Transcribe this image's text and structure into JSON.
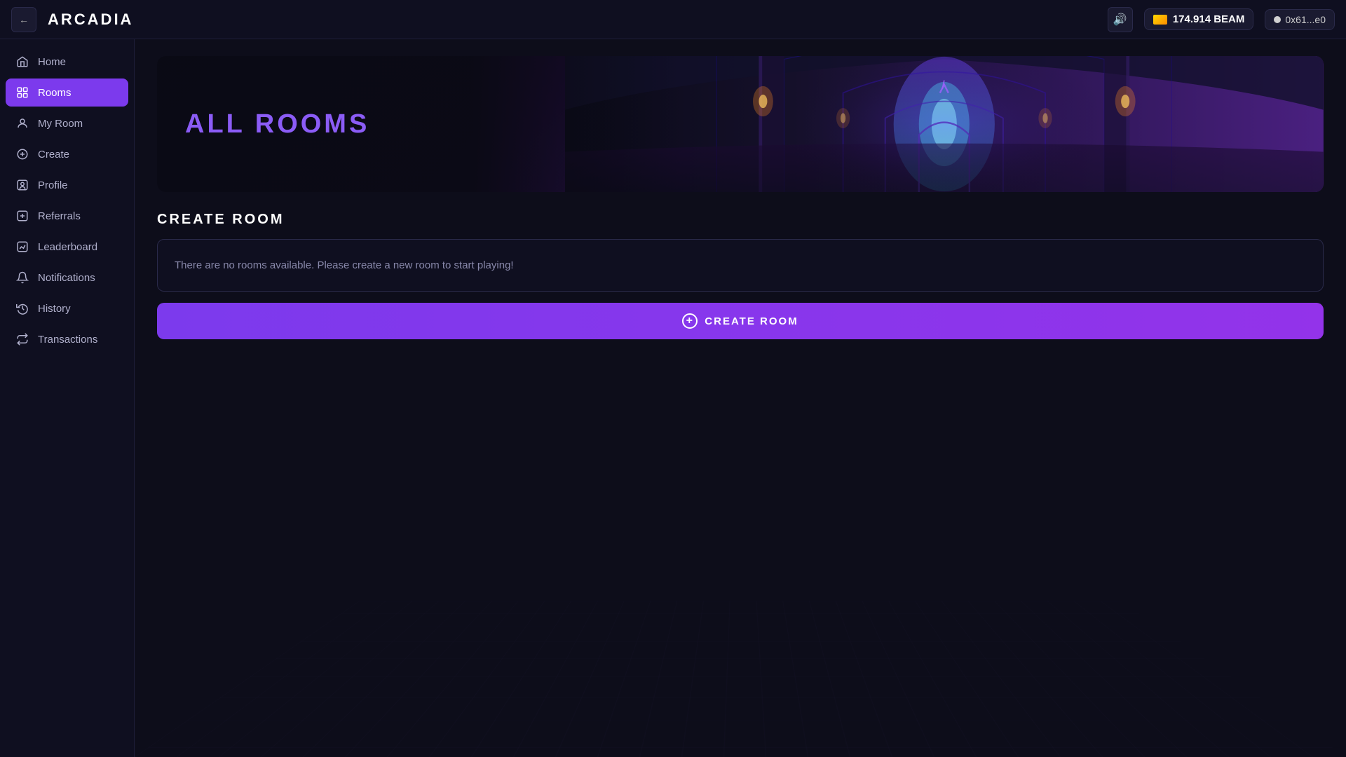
{
  "header": {
    "logo": "ARCADIA",
    "collapse_label": "←",
    "volume_icon": "🔊",
    "balance": {
      "amount": "174.914 BEAM",
      "wallet": "0x61...e0"
    }
  },
  "sidebar": {
    "items": [
      {
        "id": "home",
        "label": "Home",
        "icon": "home",
        "active": false
      },
      {
        "id": "rooms",
        "label": "Rooms",
        "icon": "rooms",
        "active": true
      },
      {
        "id": "my-room",
        "label": "My Room",
        "icon": "my-room",
        "active": false
      },
      {
        "id": "create",
        "label": "Create",
        "icon": "create",
        "active": false
      },
      {
        "id": "profile",
        "label": "Profile",
        "icon": "profile",
        "active": false
      },
      {
        "id": "referrals",
        "label": "Referrals",
        "icon": "referrals",
        "active": false
      },
      {
        "id": "leaderboard",
        "label": "Leaderboard",
        "icon": "leaderboard",
        "active": false
      },
      {
        "id": "notifications",
        "label": "Notifications",
        "icon": "notifications",
        "active": false
      },
      {
        "id": "history",
        "label": "History",
        "icon": "history",
        "active": false
      },
      {
        "id": "transactions",
        "label": "Transactions",
        "icon": "transactions",
        "active": false
      }
    ]
  },
  "main": {
    "hero": {
      "title_part1": "ALL ",
      "title_part2": "ROOMS"
    },
    "section_title": "CREATE ROOM",
    "empty_message": "There are no rooms available. Please create a new room to start playing!",
    "create_button_label": "CREATE ROOM"
  }
}
